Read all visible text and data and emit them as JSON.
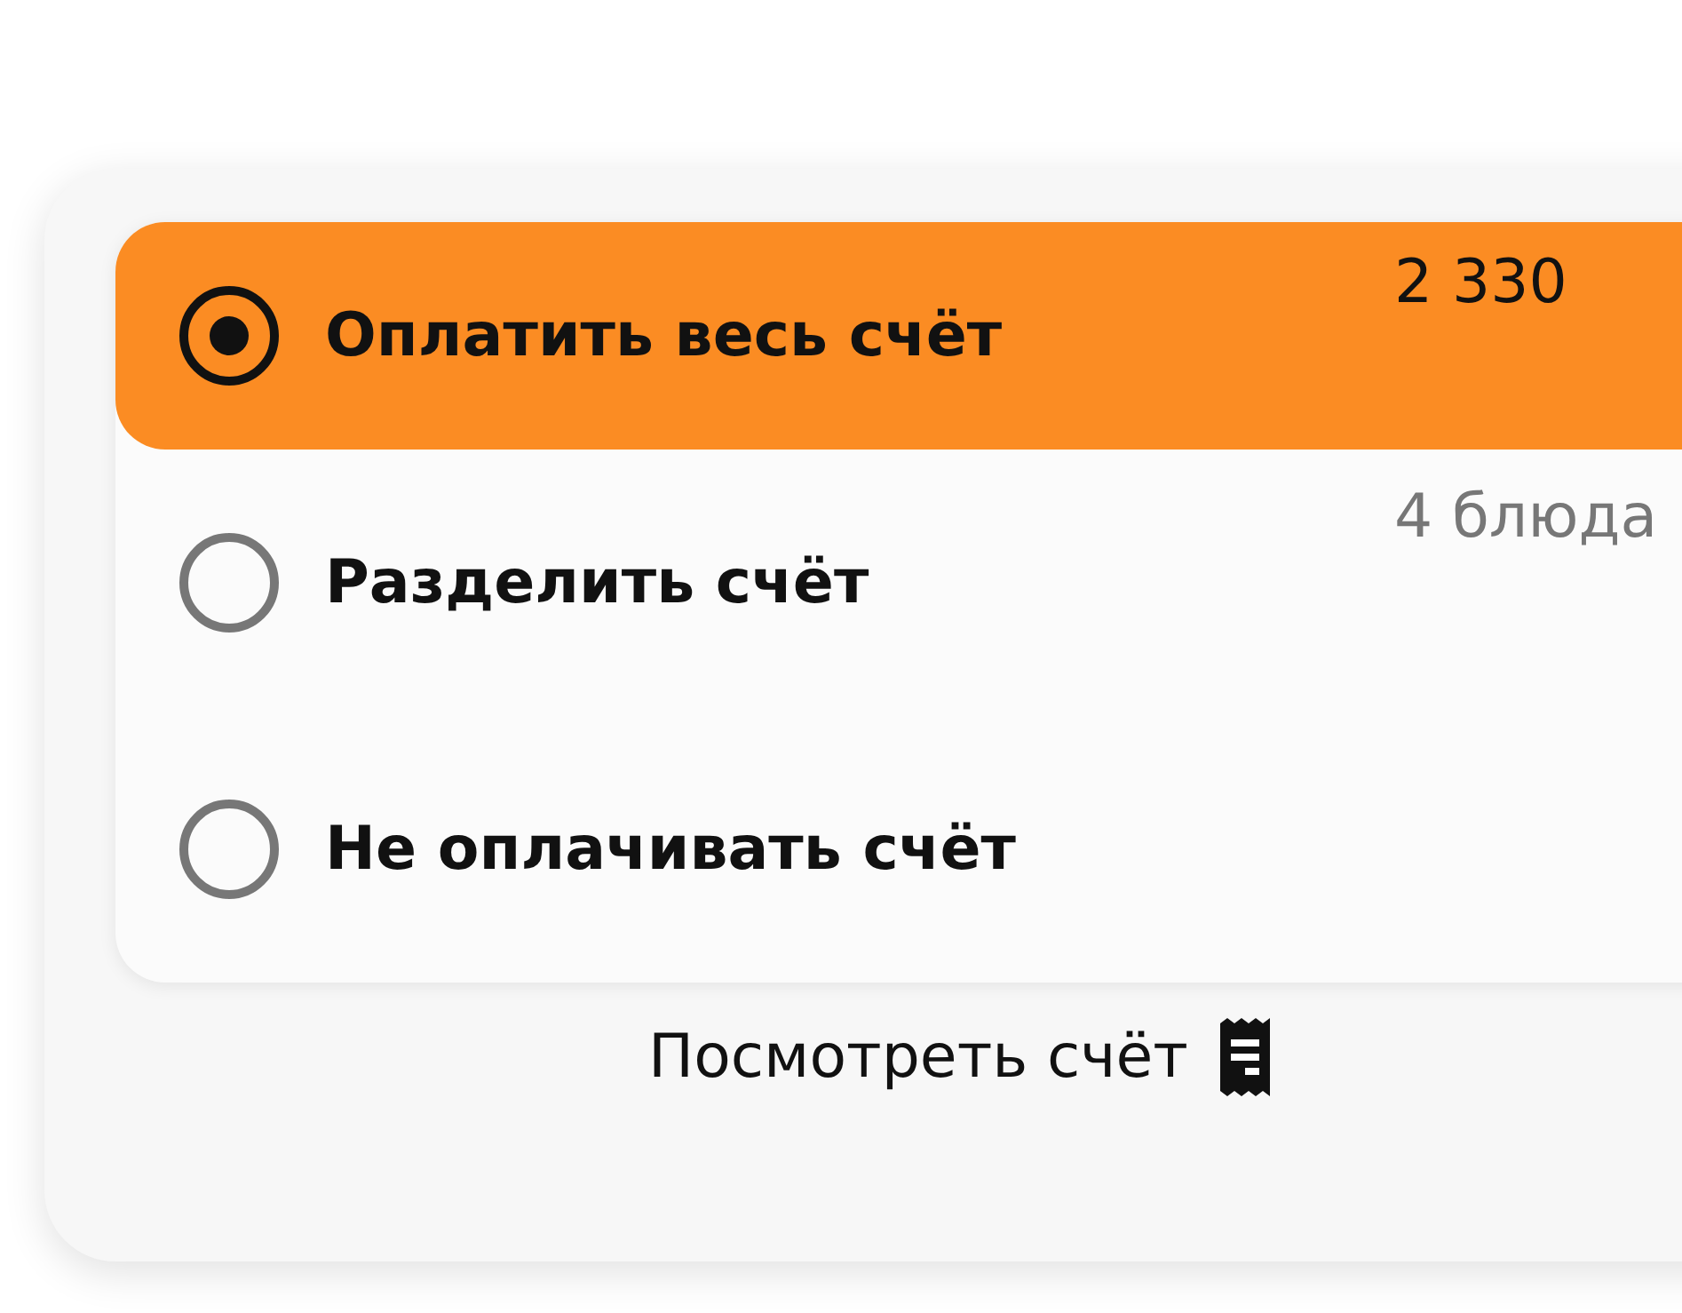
{
  "options": [
    {
      "label": "Оплатить весь счёт",
      "detail": "2 330",
      "selected": true
    },
    {
      "label": "Разделить счёт",
      "detail": "4 блюда",
      "selected": false
    },
    {
      "label": "Не оплачивать счёт",
      "selected": false
    }
  ],
  "footer_link": "Посмотреть счёт"
}
